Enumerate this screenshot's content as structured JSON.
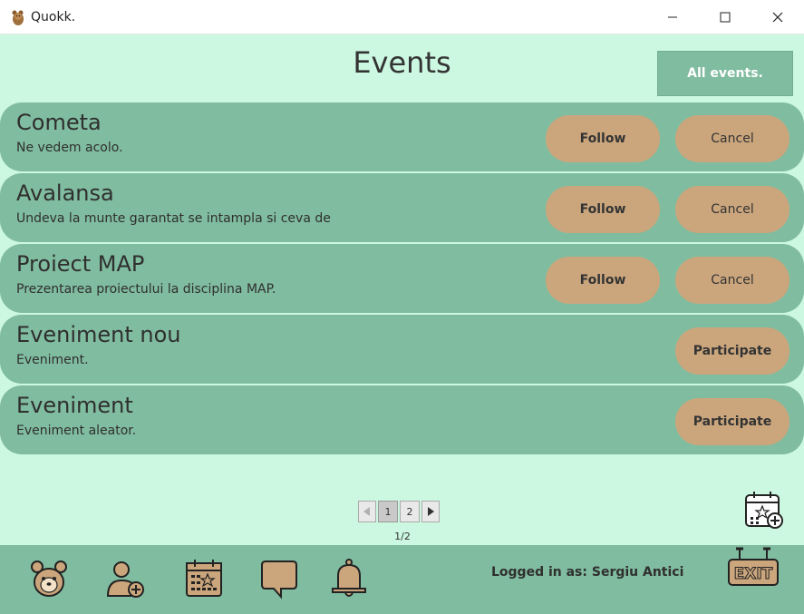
{
  "window": {
    "title": "Quokk.",
    "icon": "quokka-icon",
    "controls": [
      "minimize",
      "maximize",
      "close"
    ]
  },
  "header": {
    "title": "Events",
    "all_events_label": "All events."
  },
  "events": [
    {
      "title": "Cometa",
      "description": "Ne vedem acolo.",
      "actions": [
        "Follow",
        "Cancel"
      ]
    },
    {
      "title": "Avalansa",
      "description": "Undeva la munte garantat se intampla si ceva de g...",
      "actions": [
        "Follow",
        "Cancel"
      ]
    },
    {
      "title": "Proiect MAP",
      "description": "Prezentarea proiectului la disciplina MAP.",
      "actions": [
        "Follow",
        "Cancel"
      ]
    },
    {
      "title": "Eveniment nou",
      "description": "Eveniment.",
      "actions": [
        "Participate"
      ]
    },
    {
      "title": "Eveniment",
      "description": "Eveniment aleator.",
      "actions": [
        "Participate"
      ]
    }
  ],
  "pagination": {
    "prev": "◀",
    "pages": [
      "1",
      "2"
    ],
    "next": "▶",
    "current": 1,
    "info": "1/2"
  },
  "footer": {
    "logged_in": "Logged in as: Sergiu Antici",
    "nav_icons": [
      "quokka-profile-icon",
      "add-friend-icon",
      "calendar-icon",
      "chat-icon",
      "bell-icon"
    ],
    "exit_icon": "exit-sign-icon"
  },
  "colors": {
    "background": "#ccf7e0",
    "panel": "#80bc9f",
    "button": "#cba67d"
  }
}
